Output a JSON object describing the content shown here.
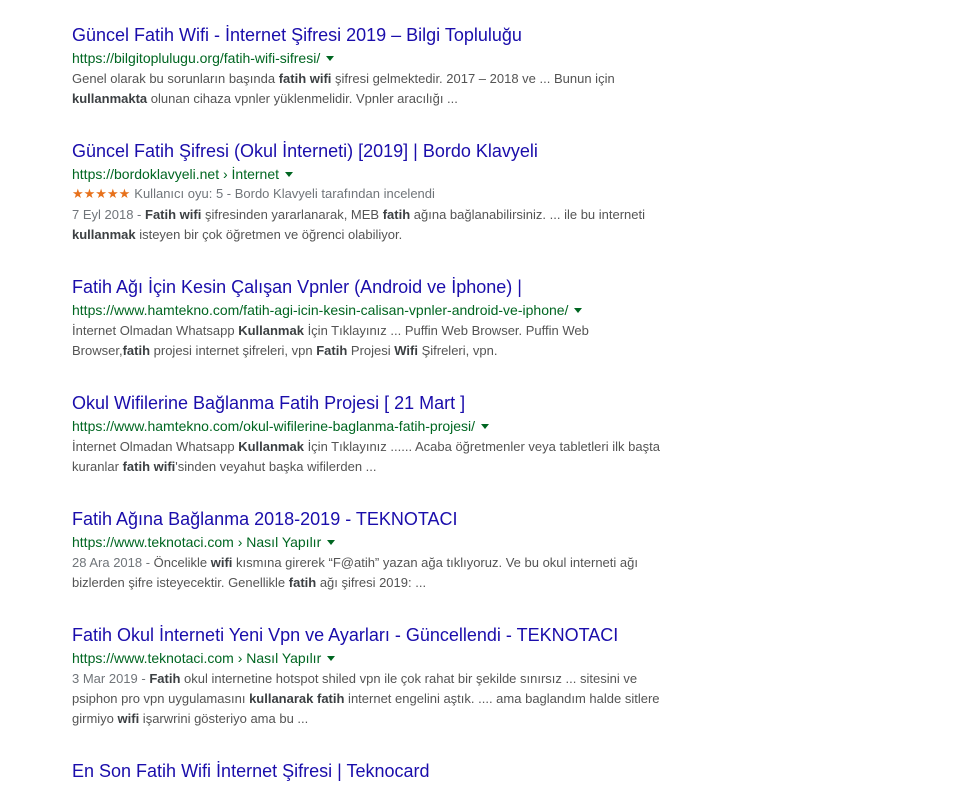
{
  "results": [
    {
      "title": "Güncel Fatih Wifi - İnternet Şifresi 2019 – Bilgi Topluluğu",
      "url": "https://bilgitoplulugu.org/fatih-wifi-sifresi/",
      "snippet_lines": [
        [
          {
            "t": "Genel olarak bu sorunların başında "
          },
          {
            "t": "fatih wifi",
            "b": true
          },
          {
            "t": " şifresi gelmektedir. 2017 – 2018 ve ... Bunun için"
          }
        ],
        [
          {
            "t": "kullanmakta",
            "b": true
          },
          {
            "t": " olunan cihaza vpnler yüklenmelidir. Vpnler aracılığı ..."
          }
        ]
      ]
    },
    {
      "title": "Güncel Fatih Şifresi (Okul İnterneti) [2019] | Bordo Klavyeli",
      "url": "https://bordoklavyeli.net › İnternet",
      "rating": {
        "stars": "★★★★★",
        "text": "Kullanıcı oyu: 5 - Bordo Klavyeli tarafından incelendi"
      },
      "snippet_lines": [
        [
          {
            "t": "7 Eyl 2018 - ",
            "d": true
          },
          {
            "t": "Fatih wifi",
            "b": true
          },
          {
            "t": " şifresinden yararlanarak, MEB "
          },
          {
            "t": "fatih",
            "b": true
          },
          {
            "t": " ağına bağlanabilirsiniz. ... ile bu interneti"
          }
        ],
        [
          {
            "t": "kullanmak",
            "b": true
          },
          {
            "t": " isteyen bir çok öğretmen ve öğrenci olabiliyor."
          }
        ]
      ]
    },
    {
      "title": "Fatih Ağı İçin Kesin Çalışan Vpnler (Android ve İphone) |",
      "url": "https://www.hamtekno.com/fatih-agi-icin-kesin-calisan-vpnler-android-ve-iphone/",
      "snippet_lines": [
        [
          {
            "t": "İnternet Olmadan Whatsapp "
          },
          {
            "t": "Kullanmak",
            "b": true
          },
          {
            "t": " İçin Tıklayınız ... Puffin Web Browser. Puffin Web"
          }
        ],
        [
          {
            "t": "Browser,"
          },
          {
            "t": "fatih",
            "b": true
          },
          {
            "t": " projesi internet şifreleri, vpn "
          },
          {
            "t": "Fatih",
            "b": true
          },
          {
            "t": " Projesi "
          },
          {
            "t": "Wifi",
            "b": true
          },
          {
            "t": " Şifreleri, vpn."
          }
        ]
      ]
    },
    {
      "title": "Okul Wifilerine Bağlanma Fatih Projesi [ 21 Mart ]",
      "url": "https://www.hamtekno.com/okul-wifilerine-baglanma-fatih-projesi/",
      "snippet_lines": [
        [
          {
            "t": "İnternet Olmadan Whatsapp "
          },
          {
            "t": "Kullanmak",
            "b": true
          },
          {
            "t": " İçin Tıklayınız ...... Acaba öğretmenler veya tabletleri ilk başta"
          }
        ],
        [
          {
            "t": "kuranlar "
          },
          {
            "t": "fatih wifi",
            "b": true
          },
          {
            "t": "'sinden veyahut başka wifilerden ..."
          }
        ]
      ]
    },
    {
      "title": "Fatih Ağına Bağlanma 2018-2019 - TEKNOTACI",
      "url": "https://www.teknotaci.com › Nasıl Yapılır",
      "snippet_lines": [
        [
          {
            "t": "28 Ara 2018 - ",
            "d": true
          },
          {
            "t": "Öncelikle "
          },
          {
            "t": "wifi",
            "b": true
          },
          {
            "t": " kısmına girerek “F@atih” yazan ağa tıklıyoruz. Ve bu okul interneti ağı"
          }
        ],
        [
          {
            "t": "bizlerden şifre isteyecektir. Genellikle "
          },
          {
            "t": "fatih",
            "b": true
          },
          {
            "t": " ağı şifresi 2019: ..."
          }
        ]
      ]
    },
    {
      "title": "Fatih Okul İnterneti Yeni Vpn ve Ayarları - Güncellendi - TEKNOTACI",
      "url": "https://www.teknotaci.com › Nasıl Yapılır",
      "snippet_lines": [
        [
          {
            "t": "3 Mar 2019 - ",
            "d": true
          },
          {
            "t": "Fatih",
            "b": true
          },
          {
            "t": " okul internetine hotspot shiled vpn ile çok rahat bir şekilde sınırsız ... sitesini ve"
          }
        ],
        [
          {
            "t": "psiphon pro vpn uygulamasını "
          },
          {
            "t": "kullanarak fatih",
            "b": true
          },
          {
            "t": " internet engelini aştık. .... ama baglandım halde sitlere"
          }
        ],
        [
          {
            "t": "girmiyo "
          },
          {
            "t": "wifi",
            "b": true
          },
          {
            "t": " işarwrini gösteriyo ama bu ..."
          }
        ]
      ]
    },
    {
      "title": "En Son Fatih Wifi İnternet Şifresi | Teknocard"
    }
  ]
}
